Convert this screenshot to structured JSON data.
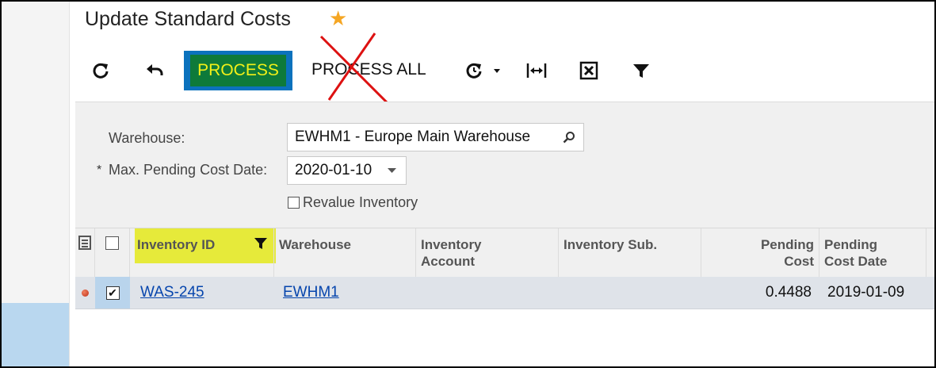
{
  "page": {
    "title": "Update Standard Costs"
  },
  "toolbar": {
    "process_label": "PROCESS",
    "process_all_label": "PROCESS ALL",
    "icons": [
      "refresh-icon",
      "undo-icon",
      "schedule-icon",
      "fit-width-icon",
      "export-excel-icon",
      "filter-icon"
    ]
  },
  "filters": {
    "warehouse_label": "Warehouse:",
    "warehouse_value": "EWHM1 - Europe Main Warehouse",
    "date_label": "Max. Pending Cost Date:",
    "date_required_mark": "*",
    "date_value": "2020-01-10",
    "revalue_label": "Revalue Inventory",
    "revalue_checked": false
  },
  "grid": {
    "columns": {
      "inventory_id": "Inventory ID",
      "warehouse": "Warehouse",
      "inventory_account_1": "Inventory",
      "inventory_account_2": "Account",
      "inventory_sub": "Inventory Sub.",
      "pending_cost_1": "Pending",
      "pending_cost_2": "Cost",
      "pending_cost_date_1": "Pending",
      "pending_cost_date_2": "Cost Date"
    },
    "rows": [
      {
        "selected": true,
        "inventory_id": "WAS-245",
        "warehouse": "EWHM1",
        "inventory_account": "",
        "inventory_sub": "",
        "pending_cost": "0.4488",
        "pending_cost_date": "2019-01-09"
      }
    ]
  },
  "colors": {
    "highlight_yellow": "#e6ea3a",
    "process_bg": "#0e7a3a",
    "process_text": "#f2f018",
    "process_border": "#0b72bd",
    "cross_red": "#d11"
  }
}
